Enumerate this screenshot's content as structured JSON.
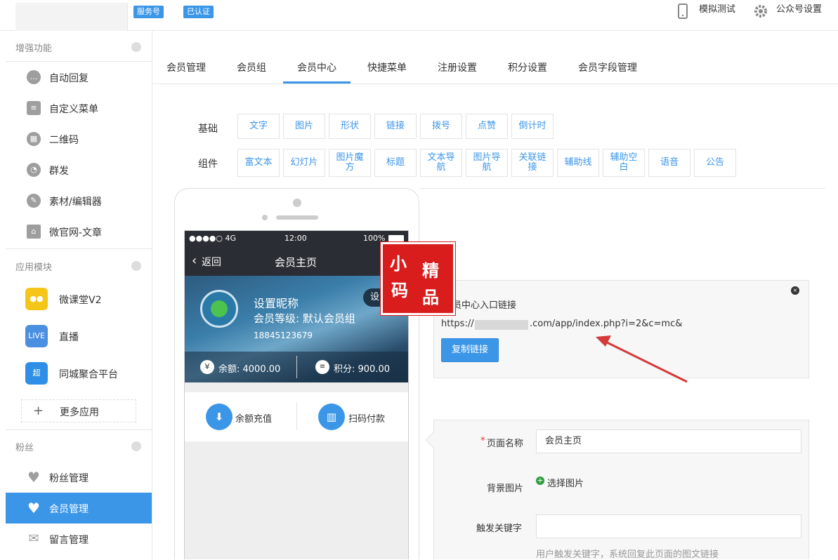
{
  "topbar": {
    "badge_service": "服务号",
    "badge_verified": "已认证",
    "simulate_test": "模拟测试",
    "account_settings": "公众号设置"
  },
  "sidebar": {
    "sections": [
      {
        "title": "增强功能",
        "items": [
          {
            "label": "自动回复",
            "icon": "chat-icon"
          },
          {
            "label": "自定义菜单",
            "icon": "menu-doc-icon"
          },
          {
            "label": "二维码",
            "icon": "qrcode-icon"
          },
          {
            "label": "群发",
            "icon": "broadcast-icon"
          },
          {
            "label": "素材/编辑器",
            "icon": "edit-icon"
          },
          {
            "label": "微官网-文章",
            "icon": "home-icon"
          }
        ]
      },
      {
        "title": "应用模块",
        "items": [
          {
            "label": "微课堂V2",
            "icon": "owl-app-icon"
          },
          {
            "label": "直播",
            "icon": "live-app-icon"
          },
          {
            "label": "同城聚合平台",
            "icon": "city-app-icon"
          }
        ],
        "more": "更多应用"
      },
      {
        "title": "粉丝",
        "items": [
          {
            "label": "粉丝管理",
            "icon": "heart-icon"
          },
          {
            "label": "会员管理",
            "icon": "heart-icon",
            "active": true
          },
          {
            "label": "留言管理",
            "icon": "mail-icon"
          }
        ]
      }
    ]
  },
  "tabs": [
    "会员管理",
    "会员组",
    "会员中心",
    "快捷菜单",
    "注册设置",
    "积分设置",
    "会员字段管理"
  ],
  "active_tab": "会员中心",
  "widgets": {
    "basic_label": "基础",
    "basic": [
      "文字",
      "图片",
      "形状",
      "链接",
      "拨号",
      "点赞",
      "倒计时"
    ],
    "component_label": "组件",
    "components": [
      "富文本",
      "幻灯片",
      "图片魔方",
      "标题",
      "文本导航",
      "图片导航",
      "关联链接",
      "辅助线",
      "辅助空白",
      "语音",
      "公告"
    ]
  },
  "phone": {
    "status_signal": "●●●●○ 4G",
    "status_time": "12:00",
    "status_battery": "100%",
    "back": "返回",
    "title": "会员主页",
    "settings_short": "设",
    "nickname": "设置昵称",
    "level": "会员等级: 默认会员组",
    "phone_number": "18845123679",
    "balance": "余额: 4000.00",
    "points": "积分: 900.00",
    "recharge": "余额充值",
    "scan_pay": "扫码付款"
  },
  "link_panel": {
    "title": "员中心入口链接",
    "url_prefix": "https://",
    "url_suffix": ".com/app/index.php?i=2&c=mc&",
    "copy_button": "复制链接"
  },
  "form": {
    "page_name_label": "页面名称",
    "page_name_value": "会员主页",
    "bg_image_label": "背景图片",
    "choose_image": "选择图片",
    "keyword_label": "触发关键字",
    "keyword_value": "",
    "keyword_hint": "用户触发关键字，系统回复此页面的图文链接"
  },
  "watermark": [
    "小",
    "精",
    "码",
    "品"
  ],
  "colors": {
    "accent": "#3c96e8",
    "stamp": "#d91d1d",
    "arrow": "#d43a3a"
  }
}
